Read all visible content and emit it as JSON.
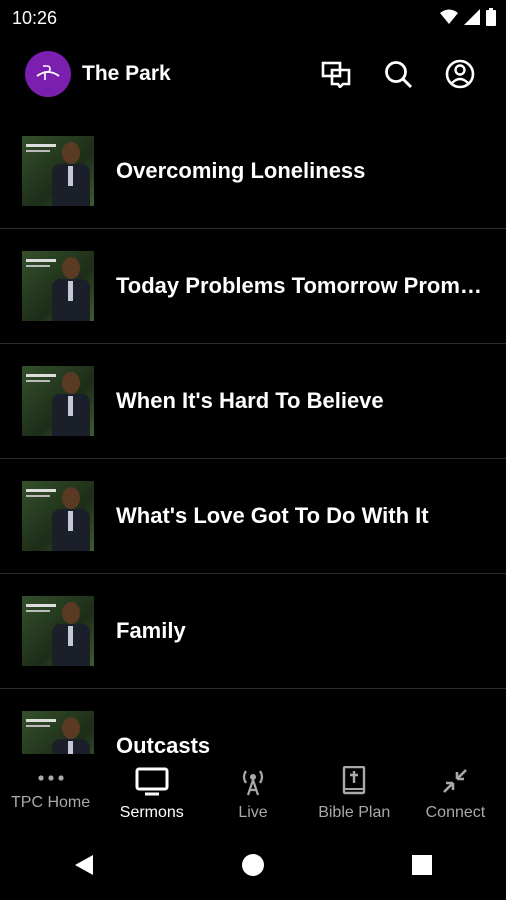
{
  "status": {
    "time": "10:26"
  },
  "app": {
    "title": "The Park"
  },
  "sermons": [
    {
      "title": "Overcoming Loneliness"
    },
    {
      "title": "Today Problems Tomorrow Promises"
    },
    {
      "title": "When It's Hard To Believe"
    },
    {
      "title": "What's Love Got To Do With It"
    },
    {
      "title": "Family"
    },
    {
      "title": "Outcasts"
    }
  ],
  "nav": [
    {
      "label": "TPC Home",
      "icon": "more-dots-icon"
    },
    {
      "label": "Sermons",
      "icon": "tv-icon"
    },
    {
      "label": "Live",
      "icon": "broadcast-icon"
    },
    {
      "label": "Bible Plan",
      "icon": "bible-icon"
    },
    {
      "label": "Connect",
      "icon": "compress-icon"
    }
  ],
  "colors": {
    "brand": "#7a1fb0",
    "background": "#000000",
    "inactive": "#a9a9a9"
  }
}
